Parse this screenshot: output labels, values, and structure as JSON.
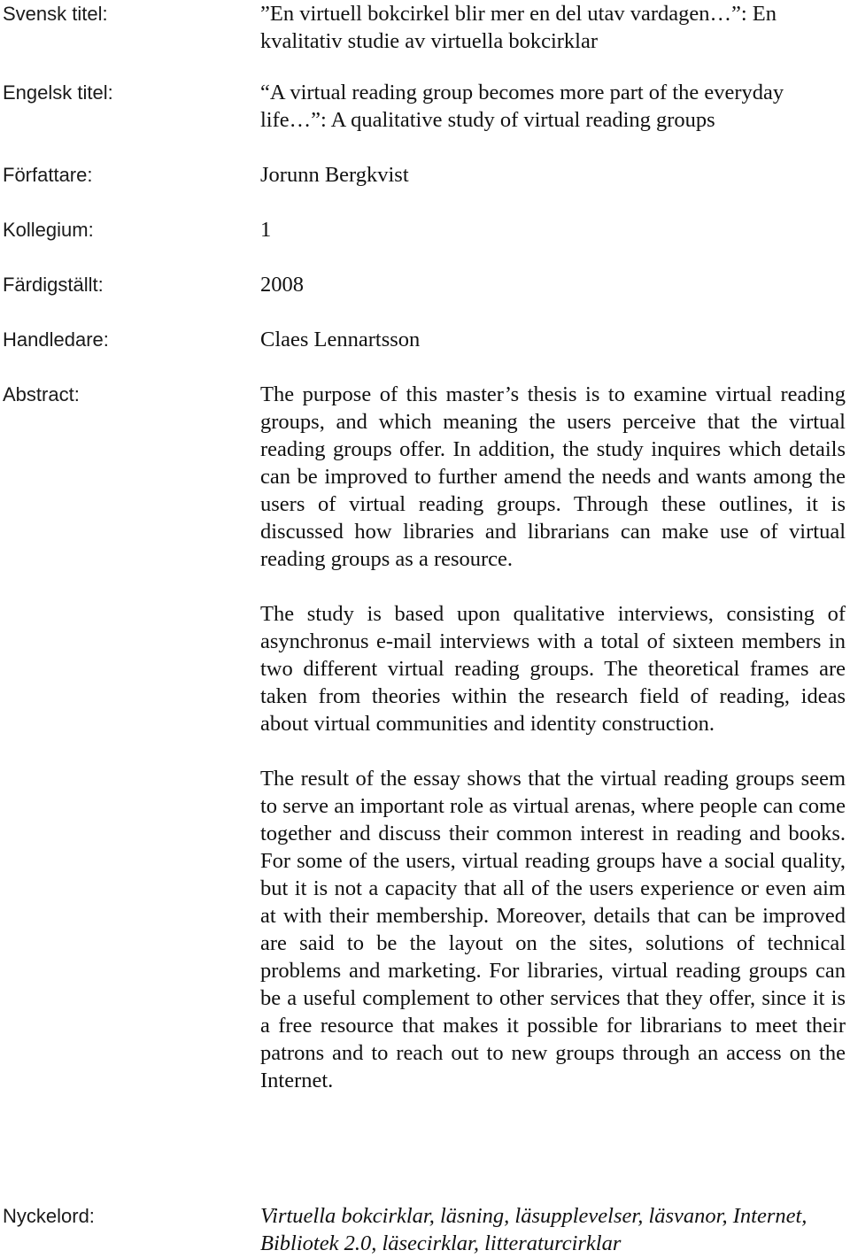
{
  "fields": {
    "swedish_title": {
      "label": "Svensk titel:",
      "value": "”En virtuell bokcirkel blir mer en del utav vardagen…”: En kvalitativ studie av virtuella bokcirklar"
    },
    "english_title": {
      "label": "Engelsk titel:",
      "value": "“A virtual reading group becomes more part of the everyday life…”: A qualitative study of virtual reading groups"
    },
    "author": {
      "label": "Författare:",
      "value": "Jorunn Bergkvist"
    },
    "kollegium": {
      "label": "Kollegium:",
      "value": "1"
    },
    "completed": {
      "label": "Färdigställt:",
      "value": "2008"
    },
    "supervisor": {
      "label": "Handledare:",
      "value": "Claes Lennartsson"
    },
    "abstract": {
      "label": "Abstract:",
      "paragraphs": [
        "The purpose of this master’s thesis is to examine virtual reading groups, and which meaning the users perceive that the virtual reading groups offer. In addition, the study inquires which details can be improved to further amend the needs and wants among the users of virtual reading groups. Through these outlines, it is discussed how libraries and librarians can make use of virtual reading groups as a resource.",
        "The study is based upon qualitative interviews, consisting of asynchronus e-mail interviews with a total of sixteen members in two different virtual reading groups. The theoretical frames are taken from theories within the research field of reading, ideas about virtual communities and identity construction.",
        "The result of the essay shows that the virtual reading groups seem to serve an important role as virtual arenas, where people can come together and discuss their common interest in reading and books. For some of the users, virtual reading groups have a social quality, but it is not a capacity that all of the users experience or even aim at with their membership. Moreover, details that can be improved are said to be the layout on the sites, solutions of technical problems and marketing. For libraries, virtual reading groups can be a useful complement to other services that they offer, since it is a free resource that makes it possible for librarians to meet their patrons and to reach out to new groups through an access on the Internet."
      ]
    },
    "keywords": {
      "label": "Nyckelord:",
      "value": "Virtuella bokcirklar, läsning, läsupplevelser, läsvanor, Internet, Bibliotek 2.0, läsecirklar, litteraturcirklar"
    }
  }
}
